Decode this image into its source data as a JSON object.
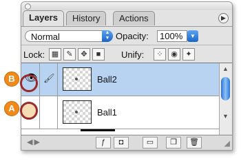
{
  "tabs": [
    "Layers",
    "History",
    "Actions"
  ],
  "panel_menu_icon": "triangle-right-icon",
  "blend_mode": "Normal",
  "opacity_label": "Opacity:",
  "opacity_value": "100%",
  "lock_label": "Lock:",
  "lock_icons": [
    "lock-transparent-icon",
    "lock-paint-icon",
    "lock-move-icon",
    "lock-all-icon"
  ],
  "unify_label": "Unify:",
  "unify_icons": [
    "unify-position-icon",
    "unify-visibility-icon",
    "unify-style-icon"
  ],
  "layers": [
    {
      "name": "Ball2",
      "selected": true
    },
    {
      "name": "Ball1",
      "selected": false
    }
  ],
  "callouts": {
    "b": "B",
    "a": "A"
  },
  "bottom_icons": [
    "link-icon",
    "style-icon",
    "mask-icon",
    "group-icon",
    "new-layer-icon",
    "trash-icon"
  ],
  "colors": {
    "callout": "#f08a1a",
    "ring": "#9b2a2a",
    "selected_row": "#b8d3f1",
    "accent": "#1c64c8"
  }
}
